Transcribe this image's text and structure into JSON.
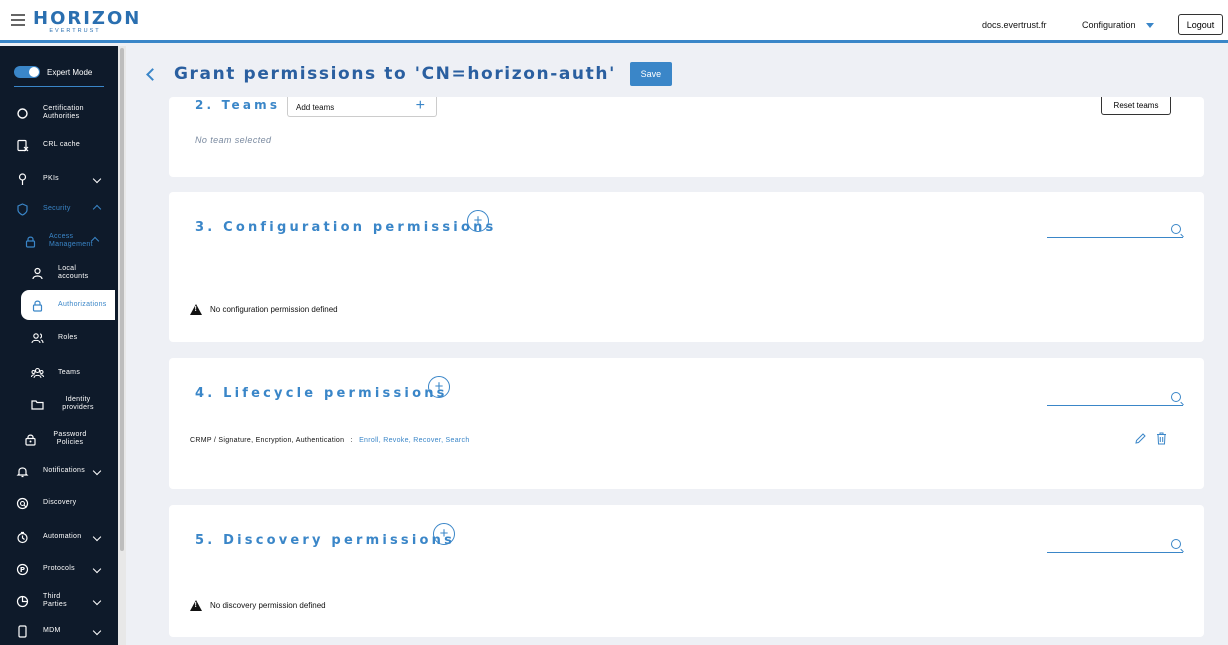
{
  "header": {
    "logo_text": "HORIZON",
    "logo_subtext": "EVERTRUST",
    "docs_link": "docs.evertrust.fr",
    "config_label": "Configuration",
    "logout_label": "Logout"
  },
  "sidebar": {
    "expert_mode_label": "Expert Mode",
    "items": [
      {
        "label": "Certification Authorities",
        "icon": "circle-icon"
      },
      {
        "label": "CRL cache",
        "icon": "crl-icon"
      },
      {
        "label": "PKIs",
        "icon": "key-icon"
      },
      {
        "label": "Security",
        "icon": "shield-icon"
      },
      {
        "label": "Access Management",
        "icon": "lock-icon"
      },
      {
        "label": "Local accounts",
        "icon": "user-icon"
      },
      {
        "label": "Authorizations",
        "icon": "lock-icon"
      },
      {
        "label": "Roles",
        "icon": "roles-icon"
      },
      {
        "label": "Teams",
        "icon": "teams-icon"
      },
      {
        "label": "Identity providers",
        "icon": "folder-icon"
      },
      {
        "label": "Password Policies",
        "icon": "password-lock-icon"
      },
      {
        "label": "Notifications",
        "icon": "bell-icon"
      },
      {
        "label": "Discovery",
        "icon": "discovery-icon"
      },
      {
        "label": "Automation",
        "icon": "automation-icon"
      },
      {
        "label": "Protocols",
        "icon": "protocol-icon"
      },
      {
        "label": "Third Parties",
        "icon": "third-party-icon"
      },
      {
        "label": "MDM",
        "icon": "mobile-icon"
      }
    ]
  },
  "page": {
    "title": "Grant permissions to 'CN=horizon-auth'",
    "save_label": "Save"
  },
  "teams": {
    "title": "2. Teams",
    "add_label": "Add teams",
    "reset_label": "Reset teams",
    "empty_text": "No team selected"
  },
  "config_perms": {
    "title": "3. Configuration permissions",
    "empty_text": "No configuration permission defined"
  },
  "lifecycle_perms": {
    "title": "4. Lifecycle permissions",
    "row_label": "CRMP / Signature, Encryption, Authentication",
    "row_sep": ":",
    "row_values": "Enroll, Revoke, Recover, Search"
  },
  "discovery_perms": {
    "title": "5. Discovery permissions",
    "empty_text": "No discovery permission defined"
  },
  "colors": {
    "accent": "#3a86c8",
    "sidebar_bg": "#0e1a2a",
    "page_bg": "#eef0f5"
  }
}
